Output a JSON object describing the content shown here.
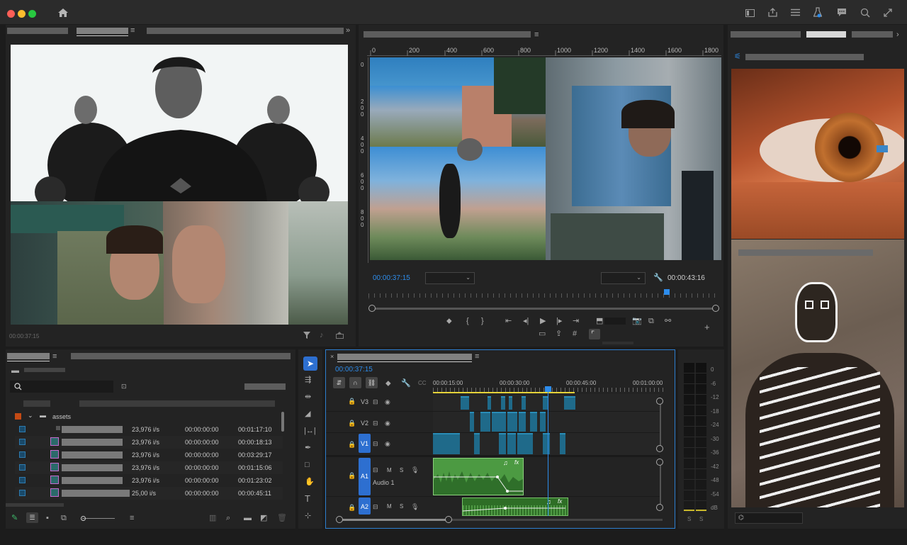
{
  "app": {
    "accent": "#2d8ceb"
  },
  "titlebar": {
    "icons": [
      "home-icon",
      "layout-icon",
      "share-icon",
      "list-icon",
      "flask-icon",
      "comment-icon",
      "zoom-icon",
      "fullscreen-icon"
    ]
  },
  "source_monitor": {
    "timecode": "00:00:37:15"
  },
  "program_monitor": {
    "ruler_labels": [
      "0",
      "200",
      "400",
      "600",
      "800",
      "1000",
      "1200",
      "1400",
      "1600",
      "1800"
    ],
    "vruler_labels": [
      "0",
      "2 0 0",
      "4 0 0",
      "6 0 0",
      "8 0 0"
    ],
    "timecode_left": "00:00:37:15",
    "timecode_right": "00:00:43:16"
  },
  "project": {
    "folder_name": "assets",
    "row_values": [
      {
        "fps": "23,976 i/s",
        "in": "00:00:00:00",
        "dur": "00:01:17:10"
      },
      {
        "fps": "23,976 i/s",
        "in": "00:00:00:00",
        "dur": "00:00:18:13"
      },
      {
        "fps": "23,976 i/s",
        "in": "00:00:00:00",
        "dur": "00:03:29:17"
      },
      {
        "fps": "23,976 i/s",
        "in": "00:00:00:00",
        "dur": "00:01:15:06"
      },
      {
        "fps": "23,976 i/s",
        "in": "00:00:00:00",
        "dur": "00:01:23:02"
      },
      {
        "fps": "25,00 i/s",
        "in": "00:00:00:00",
        "dur": "00:00:45:11"
      }
    ]
  },
  "timeline": {
    "timecode": "00:00:37:15",
    "ruler": [
      "00:00:15:00",
      "00:00:30:00",
      "00:00:45:00",
      "00:01:00:00"
    ],
    "tracks": {
      "v3": "V3",
      "v2": "V2",
      "v1": "V1",
      "a1": "A1",
      "a1_name": "Audio 1",
      "a2": "A2",
      "m": "M",
      "s": "S"
    }
  },
  "meters": {
    "labels": [
      "0",
      "-6",
      "-12",
      "-18",
      "-24",
      "-30",
      "-36",
      "-42",
      "-48",
      "-54",
      "dB"
    ],
    "s1": "S",
    "s2": "S"
  }
}
